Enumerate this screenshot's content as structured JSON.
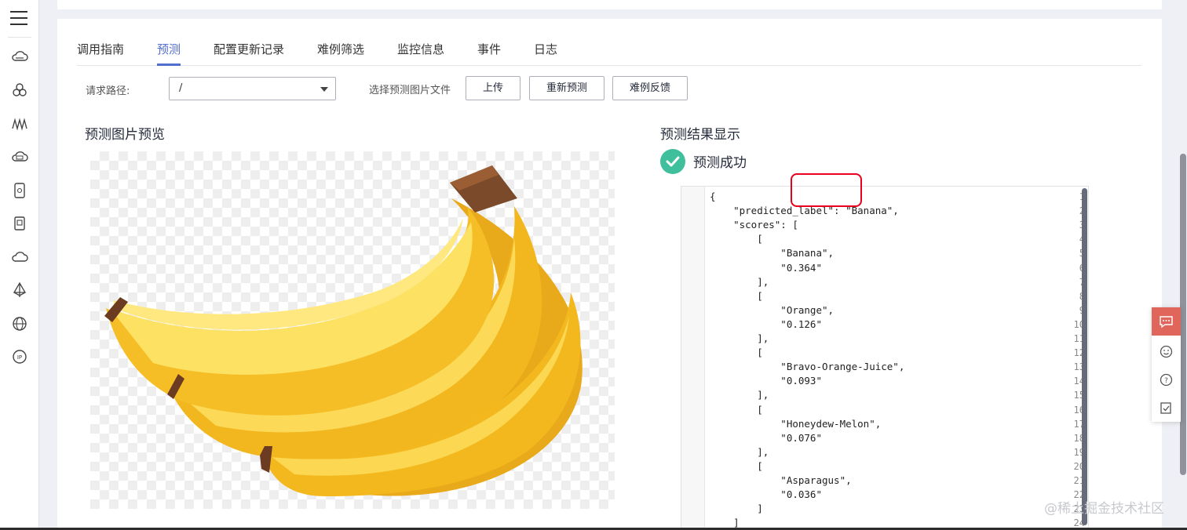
{
  "sidebar": {
    "icons": [
      "menu-icon",
      "cloud-storage-icon",
      "cluster-icon",
      "model-arts-icon",
      "cloud-db-icon",
      "tablet-icon",
      "server-icon",
      "cloud-icon",
      "tower-icon",
      "web-icon",
      "ip-icon"
    ]
  },
  "tabs": [
    {
      "label": "调用指南",
      "active": false
    },
    {
      "label": "预测",
      "active": true
    },
    {
      "label": "配置更新记录",
      "active": false
    },
    {
      "label": "难例筛选",
      "active": false
    },
    {
      "label": "监控信息",
      "active": false
    },
    {
      "label": "事件",
      "active": false
    },
    {
      "label": "日志",
      "active": false
    }
  ],
  "request": {
    "path_label": "请求路径:",
    "path_value": "/",
    "file_label": "选择预测图片文件",
    "upload_button": "上传",
    "repredict_button": "重新预测",
    "feedback_button": "难例反馈"
  },
  "preview": {
    "title": "预测图片预览"
  },
  "result": {
    "title": "预测结果显示",
    "status": "预测成功",
    "status_color": "#3fbf9b",
    "line_numbers": [
      "1",
      "2",
      "3",
      "4",
      "5",
      "6",
      "7",
      "8",
      "9",
      "10",
      "11",
      "12",
      "13",
      "14",
      "15",
      "16",
      "17",
      "18",
      "19",
      "20",
      "21",
      "22",
      "23",
      "24"
    ],
    "lines": [
      "{",
      "    \"predicted_label\": \"Banana\",",
      "    \"scores\": [",
      "        [",
      "            \"Banana\",",
      "            \"0.364\"",
      "        ],",
      "        [",
      "            \"Orange\",",
      "            \"0.126\"",
      "        ],",
      "        [",
      "            \"Bravo-Orange-Juice\",",
      "            \"0.093\"",
      "        ],",
      "        [",
      "            \"Honeydew-Melon\",",
      "            \"0.076\"",
      "        ],",
      "        [",
      "            \"Asparagus\",",
      "            \"0.036\"",
      "        ]",
      "    ]"
    ]
  },
  "float_tools": [
    "feedback-icon",
    "smile-icon",
    "help-icon",
    "survey-icon"
  ],
  "watermark": "@稀土掘金技术社区",
  "colors": {
    "accent": "#526ecc",
    "highlight": "#e8001c",
    "feedback": "#e0655b"
  }
}
